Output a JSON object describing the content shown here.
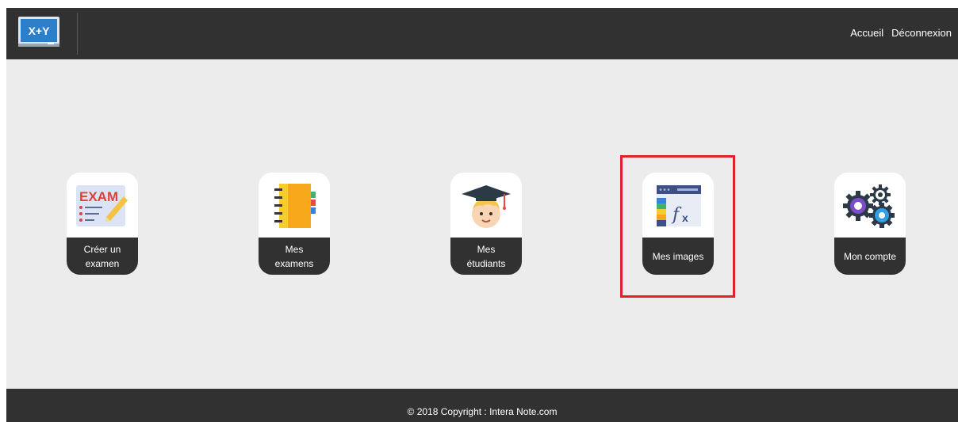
{
  "navbar": {
    "logo_text": "X+Y",
    "links": [
      "Accueil",
      "Déconnexion"
    ]
  },
  "tiles": [
    {
      "label": "Créer un examen",
      "icon": "exam-icon"
    },
    {
      "label": "Mes examens",
      "icon": "notebook-icon"
    },
    {
      "label": "Mes étudiants",
      "icon": "graduate-icon"
    },
    {
      "label": "Mes images",
      "icon": "formula-image-icon",
      "highlighted": true
    },
    {
      "label": "Mon compte",
      "icon": "gears-icon"
    }
  ],
  "footer": {
    "copyright": "© 2018 Copyright : Intera Note.com"
  },
  "colors": {
    "bar": "#313131",
    "background": "#ececec",
    "highlight": "#e0202a"
  }
}
